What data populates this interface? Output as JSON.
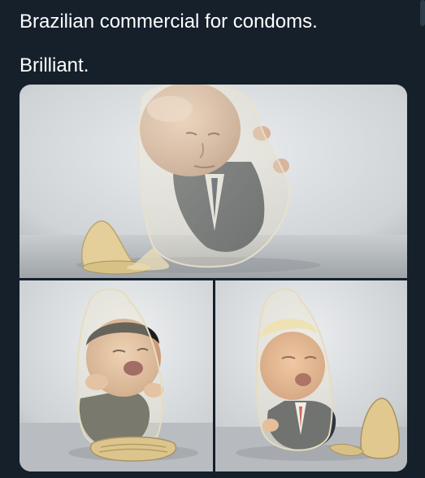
{
  "tweet": {
    "line1": "Brazilian commercial for condoms.",
    "line2": "Brilliant."
  },
  "media": {
    "images": [
      {
        "subject": "caricature figure inside stretched condom",
        "position": "top"
      },
      {
        "subject": "caricature figure inside condom",
        "position": "bottom-left"
      },
      {
        "subject": "caricature figure inside condom",
        "position": "bottom-right"
      }
    ]
  },
  "colors": {
    "background": "#15202b",
    "text": "#ffffff",
    "photo_backdrop": "#d9dcdf"
  }
}
